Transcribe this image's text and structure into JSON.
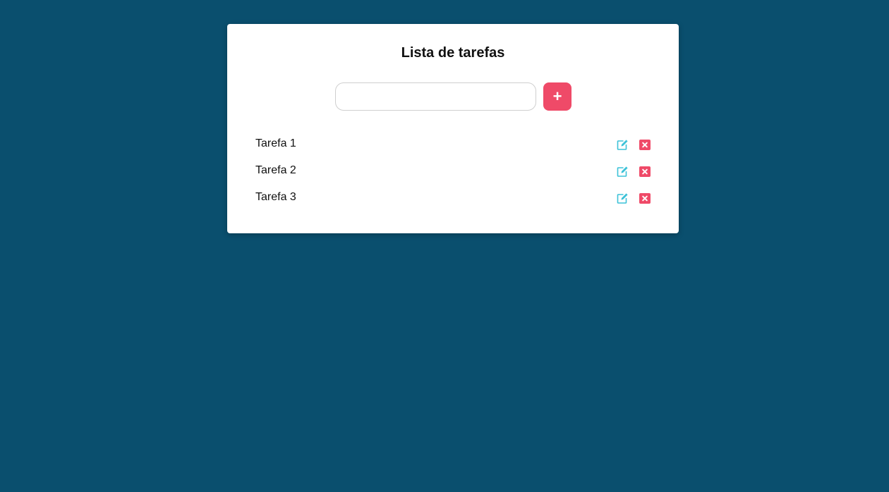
{
  "app": {
    "title": "Lista de tarefas"
  },
  "form": {
    "input_value": "",
    "input_placeholder": "",
    "add_label": "+"
  },
  "tasks": [
    {
      "text": "Tarefa 1"
    },
    {
      "text": "Tarefa 2"
    },
    {
      "text": "Tarefa 3"
    }
  ],
  "icons": {
    "edit": "edit-icon",
    "delete": "delete-icon"
  },
  "colors": {
    "background": "#0a4f6e",
    "card": "#ffffff",
    "accent": "#ef4a68",
    "edit": "#3cc2d8",
    "delete": "#ef4a68"
  }
}
